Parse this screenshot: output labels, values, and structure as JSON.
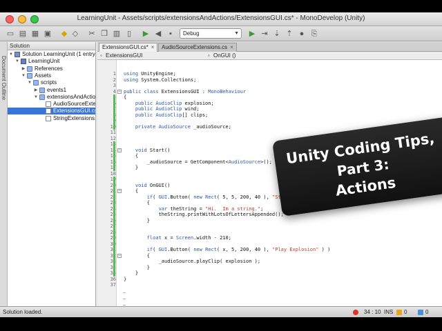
{
  "window": {
    "title": "LearningUnit - Assets/scripts/extensionsAndActions/ExtensionsGUI.cs* - MonoDevelop (Unity)"
  },
  "toolbar": {
    "configuration": "Debug"
  },
  "side_strip": {
    "label": "Document Outline"
  },
  "solution_pad": {
    "header": "Solution",
    "items": [
      {
        "label": "Solution LearningUnit (1 entry)",
        "depth": 0,
        "icon": "solution-icon",
        "expanded": true
      },
      {
        "label": "LearningUnit",
        "depth": 1,
        "icon": "project-icon",
        "expanded": true
      },
      {
        "label": "References",
        "depth": 2,
        "icon": "folder-icon",
        "expanded": false
      },
      {
        "label": "Assets",
        "depth": 2,
        "icon": "folder-icon",
        "expanded": true
      },
      {
        "label": "scripts",
        "depth": 3,
        "icon": "folder-icon",
        "expanded": true
      },
      {
        "label": "events1",
        "depth": 4,
        "icon": "folder-icon",
        "expanded": false
      },
      {
        "label": "extensionsAndActions",
        "depth": 4,
        "icon": "folder-icon",
        "expanded": true
      },
      {
        "label": "AudioSourceExtensions.cs",
        "depth": 5,
        "icon": "file-icon"
      },
      {
        "label": "ExtensionsGUI.cs",
        "depth": 5,
        "icon": "file-icon",
        "selected": true
      },
      {
        "label": "StringExtensions.cs",
        "depth": 5,
        "icon": "file-icon"
      }
    ]
  },
  "tabs": [
    {
      "label": "ExtensionsGUI.cs*",
      "active": true
    },
    {
      "label": "AudioSourceExtensions.cs",
      "active": false
    }
  ],
  "pathbar": {
    "class_label": "ExtensionsGUI",
    "method_label": "OnGUI ()"
  },
  "editor": {
    "lines": [
      [
        [
          "kw",
          "using"
        ],
        [
          "pl",
          " UnityEngine;"
        ]
      ],
      [
        [
          "kw",
          "using"
        ],
        [
          "pl",
          " System.Collections;"
        ]
      ],
      [],
      [
        [
          "kw",
          "public class"
        ],
        [
          "pl",
          " ExtensionsGUI : "
        ],
        [
          "ty",
          "MonoBehaviour"
        ]
      ],
      [
        [
          "pl",
          "{"
        ]
      ],
      [
        [
          "pl",
          "    "
        ],
        [
          "kw",
          "public"
        ],
        [
          "pl",
          " "
        ],
        [
          "ty",
          "AudioClip"
        ],
        [
          "pl",
          " explosion;"
        ]
      ],
      [
        [
          "pl",
          "    "
        ],
        [
          "kw",
          "public"
        ],
        [
          "pl",
          " "
        ],
        [
          "ty",
          "AudioClip"
        ],
        [
          "pl",
          " wind;"
        ]
      ],
      [
        [
          "pl",
          "    "
        ],
        [
          "kw",
          "public"
        ],
        [
          "pl",
          " "
        ],
        [
          "ty",
          "AudioClip"
        ],
        [
          "pl",
          "[] clips;"
        ]
      ],
      [],
      [
        [
          "pl",
          "    "
        ],
        [
          "kw",
          "private"
        ],
        [
          "pl",
          " "
        ],
        [
          "ty",
          "AudioSource"
        ],
        [
          "pl",
          " _audioSource;"
        ]
      ],
      [],
      [],
      [],
      [
        [
          "pl",
          "    "
        ],
        [
          "kw",
          "void"
        ],
        [
          "pl",
          " Start()"
        ]
      ],
      [
        [
          "pl",
          "    {"
        ]
      ],
      [
        [
          "pl",
          "        _audioSource = GetComponent<"
        ],
        [
          "ty",
          "AudioSource"
        ],
        [
          "pl",
          ">();"
        ]
      ],
      [
        [
          "pl",
          "    }"
        ]
      ],
      [],
      [],
      [
        [
          "pl",
          "    "
        ],
        [
          "kw",
          "void"
        ],
        [
          "pl",
          " OnGUI()"
        ]
      ],
      [
        [
          "pl",
          "    {"
        ]
      ],
      [
        [
          "pl",
          "        "
        ],
        [
          "kw",
          "if"
        ],
        [
          "pl",
          "( "
        ],
        [
          "ty",
          "GUI"
        ],
        [
          "pl",
          ".Button( "
        ],
        [
          "kw",
          "new"
        ],
        [
          "pl",
          " "
        ],
        [
          "ty",
          "Rect"
        ],
        [
          "pl",
          "( 5, 5, 200, 40 ), "
        ],
        [
          "str",
          "\"String Append\""
        ],
        [
          "pl",
          " ) )"
        ]
      ],
      [
        [
          "pl",
          "        {"
        ]
      ],
      [
        [
          "pl",
          "            "
        ],
        [
          "kw",
          "var"
        ],
        [
          "pl",
          " theString = "
        ],
        [
          "str",
          "\"Hi.  Im a string.\""
        ],
        [
          "pl",
          ";"
        ]
      ],
      [
        [
          "pl",
          "            theString.printWithLotsOfLettersAppended();"
        ]
      ],
      [
        [
          "pl",
          "        }"
        ]
      ],
      [],
      [],
      [
        [
          "pl",
          "        "
        ],
        [
          "kw",
          "float"
        ],
        [
          "pl",
          " x = "
        ],
        [
          "ty",
          "Screen"
        ],
        [
          "pl",
          ".width - 210;"
        ]
      ],
      [],
      [
        [
          "pl",
          "        "
        ],
        [
          "kw",
          "if"
        ],
        [
          "pl",
          "( "
        ],
        [
          "ty",
          "GUI"
        ],
        [
          "pl",
          ".Button( "
        ],
        [
          "kw",
          "new"
        ],
        [
          "pl",
          " "
        ],
        [
          "ty",
          "Rect"
        ],
        [
          "pl",
          "( x, 5, 200, 40 ), "
        ],
        [
          "str",
          "\"Play Explosion\""
        ],
        [
          "pl",
          " ) )"
        ]
      ],
      [
        [
          "pl",
          "        {"
        ]
      ],
      [
        [
          "pl",
          "            _audioSource.playClip( explosion );"
        ]
      ],
      [
        [
          "pl",
          "        }"
        ]
      ],
      [
        [
          "pl",
          "    }"
        ]
      ],
      [
        [
          "pl",
          "}"
        ]
      ],
      []
    ],
    "tilde_count": 6
  },
  "overlay": {
    "line1": "Unity Coding Tips,",
    "line2": "Part 3:",
    "line3": "Actions"
  },
  "statusbar": {
    "message": "Solution loaded.",
    "cursor_position": "34 : 10",
    "insert_mode": "INS",
    "errors": "0",
    "warnings": "0"
  }
}
